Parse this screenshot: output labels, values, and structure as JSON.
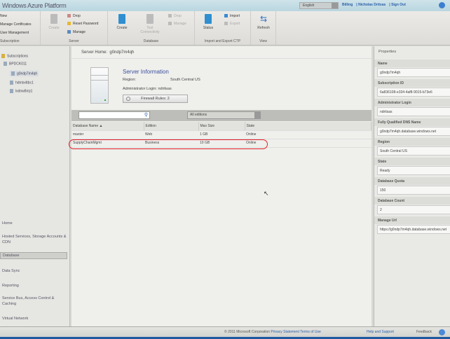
{
  "header": {
    "title": "Windows Azure Platform",
    "language": "English",
    "links": [
      "Billing",
      "Nicholas Dritsas",
      "Sign Out"
    ]
  },
  "ribbon": {
    "subscriptions": {
      "items": [
        "New",
        "Manage Certificates",
        "User Management"
      ],
      "label": "Subscription"
    },
    "server": {
      "create": "Create",
      "drop": "Drop",
      "reset": "Reset Password",
      "manage": "Manage",
      "label": "Server"
    },
    "database": {
      "create": "Create",
      "test": "Test Connectivity",
      "drop": "Drop",
      "manage": "Manage",
      "label": "Database"
    },
    "importexport": {
      "status": "Status",
      "import": "Import",
      "export": "Export",
      "label": "Import and Export CTP"
    },
    "view": {
      "refresh": "Refresh",
      "label": "View"
    }
  },
  "sidebar": {
    "root": "Subscriptions",
    "subscription": "BPDCK011",
    "servers": [
      "g0ndp7m4qh",
      "hdmtx4tbc1",
      "lxdnw8rrp1"
    ],
    "nav": [
      "Home",
      "Hosted Services, Storage Accounts & CDN",
      "Database",
      "Data Sync",
      "Reporting",
      "Service Bus, Access Control & Caching",
      "Virtual Network"
    ]
  },
  "server": {
    "home_label": "Server Home:",
    "name": "g0ndp7m4qh",
    "info_title": "Server Information",
    "region_label": "Region:",
    "region": "South Central US",
    "admin_label": "Administrator Login:",
    "admin": "ndritsas",
    "firewall": "Firewall Rules: 2"
  },
  "filter": {
    "search_placeholder": "",
    "edition": "All editions"
  },
  "table": {
    "columns": [
      "Database Name ▲",
      "Edition",
      "Max Size",
      "State"
    ],
    "rows": [
      [
        "master",
        "Web",
        "1 GB",
        "Online"
      ],
      [
        "SupplyChainMgmt",
        "Business",
        "10 GB",
        "Online"
      ]
    ]
  },
  "properties": {
    "title": "Properties",
    "items": [
      {
        "label": "Name",
        "value": "g0ndp7m4qh"
      },
      {
        "label": "Subscription ID",
        "value": "6a836108-e334-4af8-9015-b73e6"
      },
      {
        "label": "Administrator Login",
        "value": "ndritsas"
      },
      {
        "label": "Fully Qualified DNS Name",
        "value": "g0ndp7m4qh.database.windows.net"
      },
      {
        "label": "Region",
        "value": "South Central US"
      },
      {
        "label": "State",
        "value": "Ready"
      },
      {
        "label": "Database Quota",
        "value": "150"
      },
      {
        "label": "Database Count",
        "value": "2"
      },
      {
        "label": "Manage Url",
        "value": "https://g0ndp7m4qh.database.windows.net"
      }
    ]
  },
  "footer": {
    "copyright": "© 2011 Microsoft Corporation",
    "privacy": "Privacy Statement",
    "terms": "Terms of Use",
    "help": "Help and Support",
    "feedback": "Feedback"
  }
}
